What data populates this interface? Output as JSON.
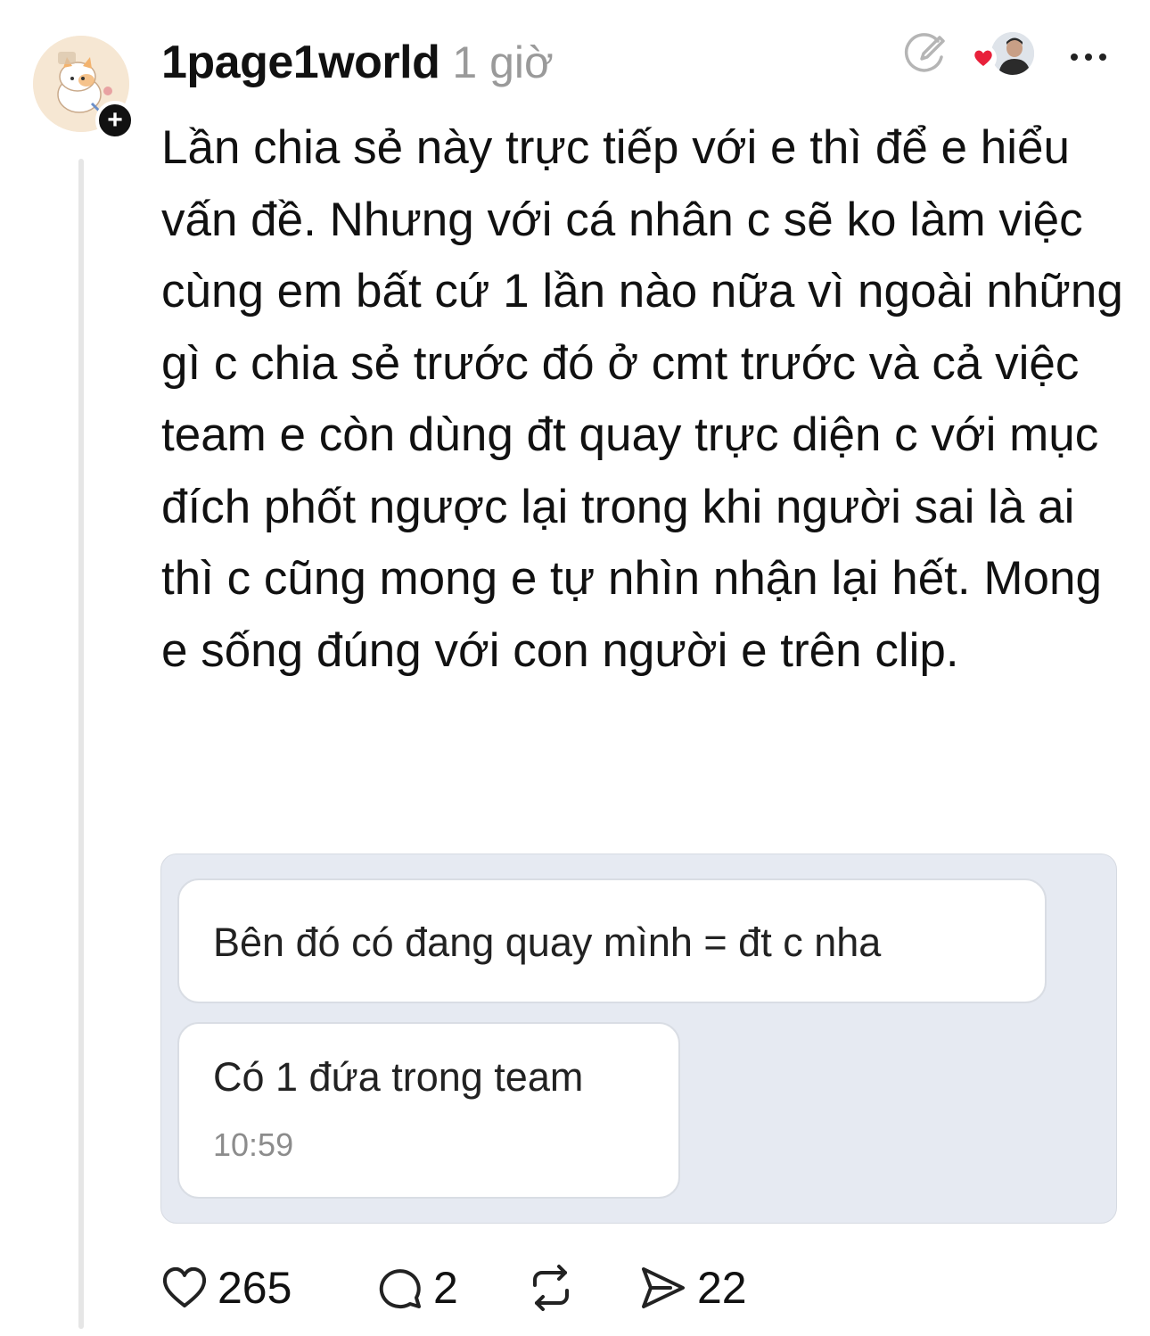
{
  "post": {
    "username": "1page1world",
    "time": "1 giờ",
    "text": "Lần chia sẻ này trực tiếp với e thì để e hiểu vấn đề. Nhưng với cá nhân c sẽ ko làm việc cùng em bất cứ 1 lần nào nữa vì ngoài những gì c chia sẻ trước đó ở cmt trước và cả việc team e còn dùng đt quay trực diện c với mục đích phốt ngược lại trong khi người sai là ai thì c cũng mong e tự nhìn nhận lại hết. Mong e sống đúng với con người e trên clip."
  },
  "attachment": {
    "message1": "Bên đó có đang quay mình = đt c nha",
    "message2": "Có 1 đứa trong team",
    "timestamp": "10:59"
  },
  "actions": {
    "likes": "265",
    "replies": "2",
    "shares": "22"
  },
  "icons": {
    "follow": "plus-icon",
    "edit": "edit-icon",
    "more": "more-icon",
    "like": "heart-icon",
    "reply": "comment-icon",
    "repost": "repost-icon",
    "share": "send-icon"
  },
  "colors": {
    "text": "#111111",
    "muted": "#9a9a9a",
    "heart": "#e8203a",
    "attachment_bg": "#e6eaf2"
  }
}
